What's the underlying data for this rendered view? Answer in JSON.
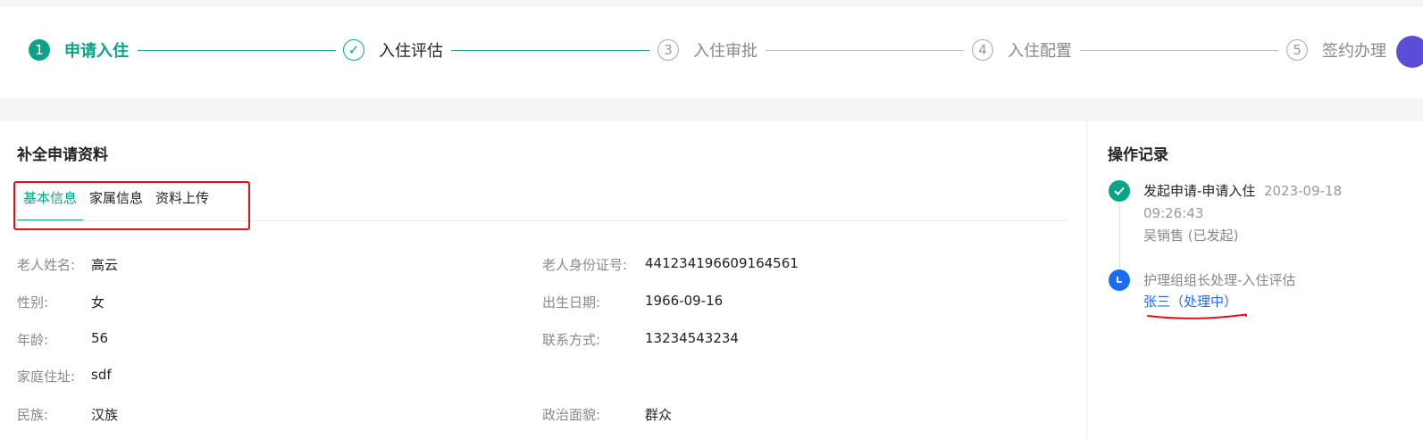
{
  "steps": [
    {
      "num": "1",
      "label": "申请入住",
      "state": "done"
    },
    {
      "num": "✓",
      "label": "入住评估",
      "state": "active"
    },
    {
      "num": "3",
      "label": "入住审批",
      "state": "todo"
    },
    {
      "num": "4",
      "label": "入住配置",
      "state": "todo"
    },
    {
      "num": "5",
      "label": "签约办理",
      "state": "todo"
    }
  ],
  "left": {
    "title": "补全申请资料",
    "tabs": [
      "基本信息",
      "家属信息",
      "资料上传"
    ],
    "fields": [
      {
        "label": "老人姓名:",
        "value": "高云"
      },
      {
        "label": "老人身份证号:",
        "value": "441234196609164561"
      },
      {
        "label": "性别:",
        "value": "女"
      },
      {
        "label": "出生日期:",
        "value": "1966-09-16"
      },
      {
        "label": "年龄:",
        "value": "56"
      },
      {
        "label": "联系方式:",
        "value": "13234543234"
      },
      {
        "label": "家庭住址:",
        "value": "sdf"
      },
      {
        "label": "民族:",
        "value": "汉族"
      },
      {
        "label": "政治面貌:",
        "value": "群众"
      }
    ]
  },
  "right": {
    "title": "操作记录",
    "records": [
      {
        "title": "发起申请-申请入住",
        "time": "2023-09-18 09:26:43",
        "person": "吴销售 (已发起)",
        "status": "done"
      },
      {
        "title": "护理组组长处理-入住评估",
        "person": "张三（处理中）",
        "status": "processing"
      }
    ]
  },
  "colors": {
    "accent": "#0aa38a",
    "processing": "#1c6cf0",
    "highlight": "#e0101e"
  }
}
